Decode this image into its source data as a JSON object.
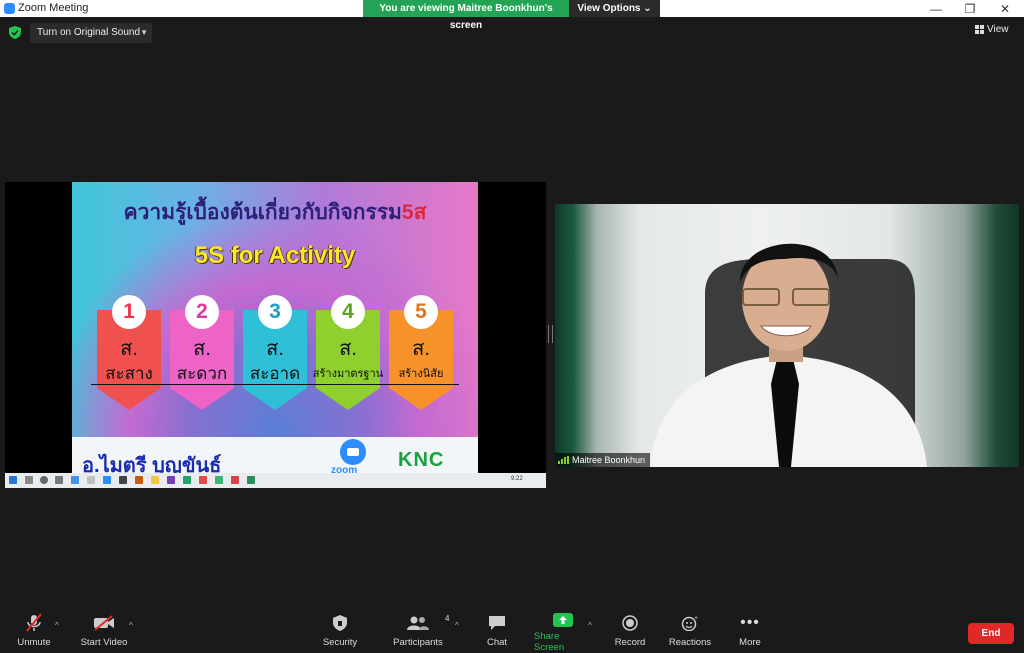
{
  "window": {
    "title": "Zoom Meeting"
  },
  "share_banner": {
    "viewing": "You are viewing Maitree Boonkhun's screen",
    "view_options": "View Options"
  },
  "top": {
    "original_sound": "Turn on Original Sound",
    "view": "View"
  },
  "slide": {
    "title_thai": "ความรู้เบื้องต้นเกี่ยวกับกิจกรรม",
    "title_five": "5ส",
    "subtitle": "5S for Activity",
    "cards": [
      {
        "num": "1",
        "so": "ส.",
        "word": "สะสาง",
        "color": "#f0504e",
        "numColor": "#e8384c"
      },
      {
        "num": "2",
        "so": "ส.",
        "word": "สะดวก",
        "color": "#ee63c6",
        "numColor": "#d63a9b"
      },
      {
        "num": "3",
        "so": "ส.",
        "word": "สะอาด",
        "color": "#2fbfd6",
        "numColor": "#1f9dc2"
      },
      {
        "num": "4",
        "so": "ส.",
        "word": "สร้างมาตรฐาน",
        "color": "#8fd02e",
        "numColor": "#5fa21e"
      },
      {
        "num": "5",
        "so": "ส.",
        "word": "สร้างนิสัย",
        "color": "#f7922a",
        "numColor": "#e3741a"
      }
    ],
    "author": "อ.ไมตรี บุญขันธ์",
    "zoom_label": "zoom",
    "logo": "KNC",
    "clock": "9:22"
  },
  "participant": {
    "name": "Maitree Boonkhun"
  },
  "toolbar": {
    "unmute": "Unmute",
    "start_video": "Start Video",
    "security": "Security",
    "participants": "Participants",
    "participants_count": "4",
    "chat": "Chat",
    "share_screen": "Share Screen",
    "record": "Record",
    "reactions": "Reactions",
    "more": "More",
    "end": "End"
  }
}
